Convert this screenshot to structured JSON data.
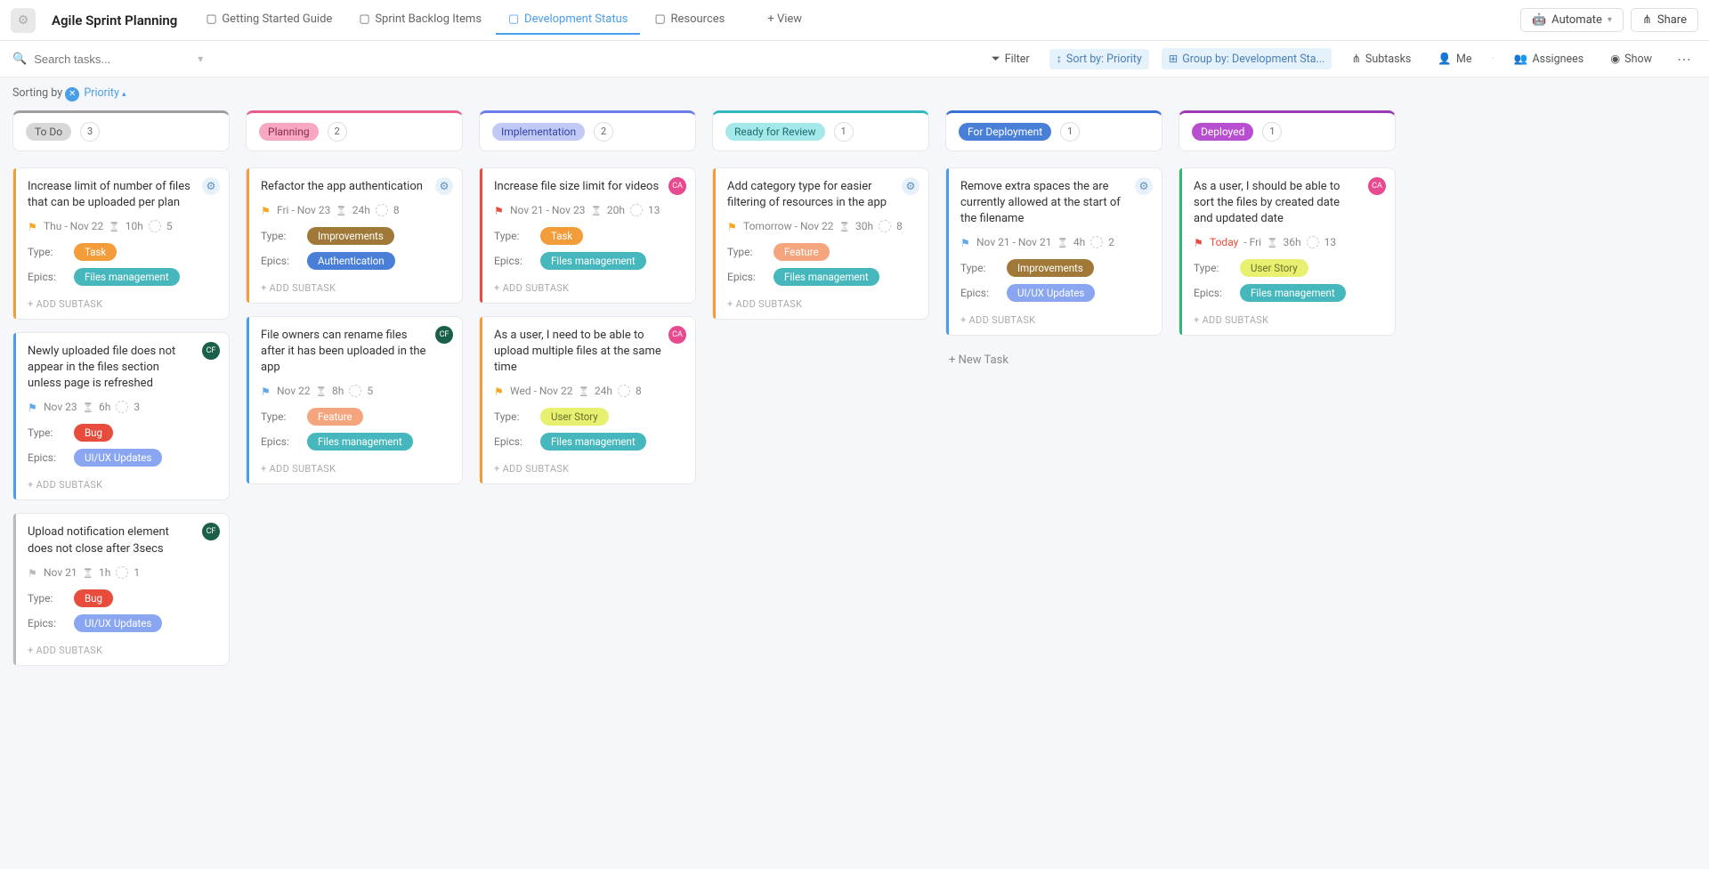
{
  "header": {
    "title": "Agile Sprint Planning",
    "tabs": [
      {
        "label": "Getting Started Guide",
        "active": false
      },
      {
        "label": "Sprint Backlog Items",
        "active": false
      },
      {
        "label": "Development Status",
        "active": true
      },
      {
        "label": "Resources",
        "active": false
      },
      {
        "label": "+ View",
        "active": false
      }
    ],
    "automate": "Automate",
    "share": "Share"
  },
  "toolbar": {
    "search_placeholder": "Search tasks...",
    "filter": "Filter",
    "sortby": "Sort by: Priority",
    "groupby": "Group by: Development Sta...",
    "subtasks": "Subtasks",
    "me": "Me",
    "assignees": "Assignees",
    "show": "Show"
  },
  "sorting": {
    "label": "Sorting by",
    "field": "Priority"
  },
  "columns": [
    {
      "name": "To Do",
      "count": 3,
      "border": "#9e9e9e",
      "pill_bg": "#d7d7d7",
      "pill_color": "#555",
      "cards": [
        {
          "title": "Increase limit of number of files that can be uploaded per plan",
          "bar": "#f39c3a",
          "avatar": "settings",
          "flag": "yellow",
          "dates": "Thu - Nov 22",
          "hours": "10h",
          "count": "5",
          "type": {
            "text": "Task",
            "class": "tag-task"
          },
          "epic": {
            "text": "Files management",
            "class": "tag-files"
          }
        },
        {
          "title": "Newly uploaded file does not appear in the files section unless page is refreshed",
          "bar": "#4a9de8",
          "avatar": "green",
          "flag": "blue",
          "dates": "Nov 23",
          "hours": "6h",
          "count": "3",
          "type": {
            "text": "Bug",
            "class": "tag-bug"
          },
          "epic": {
            "text": "UI/UX Updates",
            "class": "tag-uiux"
          }
        },
        {
          "title": "Upload notification element does not close after 3secs",
          "bar": "#bbb",
          "avatar": "green",
          "flag": "grey",
          "dates": "Nov 21",
          "hours": "1h",
          "count": "1",
          "type": {
            "text": "Bug",
            "class": "tag-bug"
          },
          "epic": {
            "text": "UI/UX Updates",
            "class": "tag-uiux"
          }
        }
      ]
    },
    {
      "name": "Planning",
      "count": 2,
      "border": "#e85f8a",
      "pill_bg": "#f7a7c2",
      "pill_color": "#8a2a4e",
      "cards": [
        {
          "title": "Refactor the app authentication",
          "bar": "#f39c3a",
          "avatar": "settings",
          "flag": "yellow",
          "dates": "Fri - Nov 23",
          "hours": "24h",
          "count": "8",
          "type": {
            "text": "Improvements",
            "class": "tag-improvements"
          },
          "epic": {
            "text": "Authentication",
            "class": "tag-auth"
          }
        },
        {
          "title": "File owners can rename files after it has been uploaded in the app",
          "bar": "#4a9de8",
          "avatar": "green",
          "flag": "blue",
          "dates": "Nov 22",
          "hours": "8h",
          "count": "5",
          "type": {
            "text": "Feature",
            "class": "tag-feature"
          },
          "epic": {
            "text": "Files management",
            "class": "tag-files"
          }
        }
      ]
    },
    {
      "name": "Implementation",
      "count": 2,
      "border": "#6a7de8",
      "pill_bg": "#c2c9f5",
      "pill_color": "#3544a5",
      "cards": [
        {
          "title": "Increase file size limit for videos",
          "bar": "#e74c3c",
          "avatar": "pink",
          "flag": "red",
          "dates": "Nov 21 - Nov 23",
          "hours": "20h",
          "count": "13",
          "type": {
            "text": "Task",
            "class": "tag-task"
          },
          "epic": {
            "text": "Files management",
            "class": "tag-files"
          }
        },
        {
          "title": "As a user, I need to be able to upload multiple files at the same time",
          "bar": "#f39c3a",
          "avatar": "pink",
          "flag": "yellow",
          "dates": "Wed - Nov 22",
          "hours": "24h",
          "count": "8",
          "type": {
            "text": "User Story",
            "class": "tag-userstory"
          },
          "epic": {
            "text": "Files management",
            "class": "tag-files"
          }
        }
      ]
    },
    {
      "name": "Ready for Review",
      "count": 1,
      "border": "#2fb8be",
      "pill_bg": "#a5e8ea",
      "pill_color": "#1a6b6e",
      "cards": [
        {
          "title": "Add category type for easier filtering of resources in the app",
          "bar": "#f39c3a",
          "avatar": "settings",
          "flag": "yellow",
          "dates": "Tomorrow - Nov 22",
          "hours": "30h",
          "count": "8",
          "type": {
            "text": "Feature",
            "class": "tag-feature"
          },
          "epic": {
            "text": "Files management",
            "class": "tag-files"
          }
        }
      ],
      "no_new_task": true
    },
    {
      "name": "For Deployment",
      "count": 1,
      "border": "#3a6fd8",
      "pill_bg": "#4a7fd8",
      "pill_color": "#fff",
      "cards": [
        {
          "title": "Remove extra spaces the are currently allowed at the start of the filename",
          "bar": "#4a9de8",
          "avatar": "settings",
          "flag": "blue",
          "dates": "Nov 21 - Nov 21",
          "hours": "4h",
          "count": "2",
          "type": {
            "text": "Improvements",
            "class": "tag-improvements"
          },
          "epic": {
            "text": "UI/UX Updates",
            "class": "tag-uiux"
          }
        }
      ],
      "show_new_task": true
    },
    {
      "name": "Deployed",
      "count": 1,
      "border": "#9c3ab5",
      "pill_bg": "#b84fd1",
      "pill_color": "#fff",
      "cards": [
        {
          "title": "As a user, I should be able to sort the files by created date and updated date",
          "bar": "#2fb871",
          "avatar": "pink",
          "flag": "red",
          "dates_pre": "Today",
          "dates": " - Fri",
          "hours": "36h",
          "count": "13",
          "date_red": true,
          "type": {
            "text": "User Story",
            "class": "tag-userstory"
          },
          "epic": {
            "text": "Files management",
            "class": "tag-files"
          }
        }
      ]
    }
  ],
  "labels": {
    "type": "Type:",
    "epics": "Epics:",
    "add_subtask": "+ ADD SUBTASK",
    "new_task": "+ New Task"
  }
}
